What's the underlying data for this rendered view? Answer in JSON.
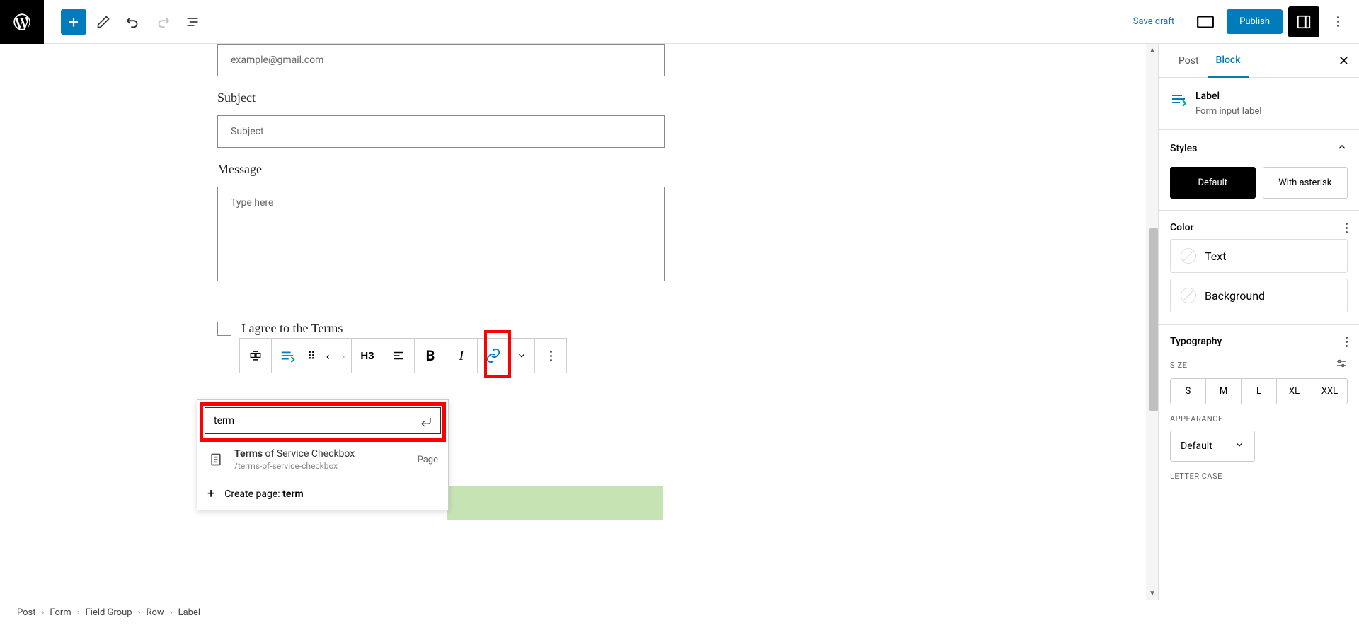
{
  "topbar": {
    "save_draft": "Save draft",
    "publish": "Publish"
  },
  "editor": {
    "email_placeholder": "example@gmail.com",
    "subject_label": "Subject",
    "subject_placeholder": "Subject",
    "message_label": "Message",
    "message_placeholder": "Type here",
    "agree_label": "I agree to the Terms",
    "block_toolbar": {
      "h3": "H3"
    }
  },
  "link_popup": {
    "search_value": "term",
    "result_title_bold": "Terms",
    "result_title_rest": " of Service Checkbox",
    "result_url": "/terms-of-service-checkbox",
    "result_type": "Page",
    "create_prefix": "Create page: ",
    "create_term": "term"
  },
  "sidebar": {
    "tabs": {
      "post": "Post",
      "block": "Block"
    },
    "block": {
      "name": "Label",
      "desc": "Form input label"
    },
    "styles": {
      "title": "Styles",
      "default": "Default",
      "asterisk": "With asterisk"
    },
    "color": {
      "title": "Color",
      "text": "Text",
      "background": "Background"
    },
    "typography": {
      "title": "Typography",
      "size_label": "SIZE",
      "sizes": [
        "S",
        "M",
        "L",
        "XL",
        "XXL"
      ],
      "appearance_label": "APPEARANCE",
      "appearance_value": "Default",
      "lettercase_label": "LETTER CASE"
    }
  },
  "breadcrumb": [
    "Post",
    "Form",
    "Field Group",
    "Row",
    "Label"
  ]
}
